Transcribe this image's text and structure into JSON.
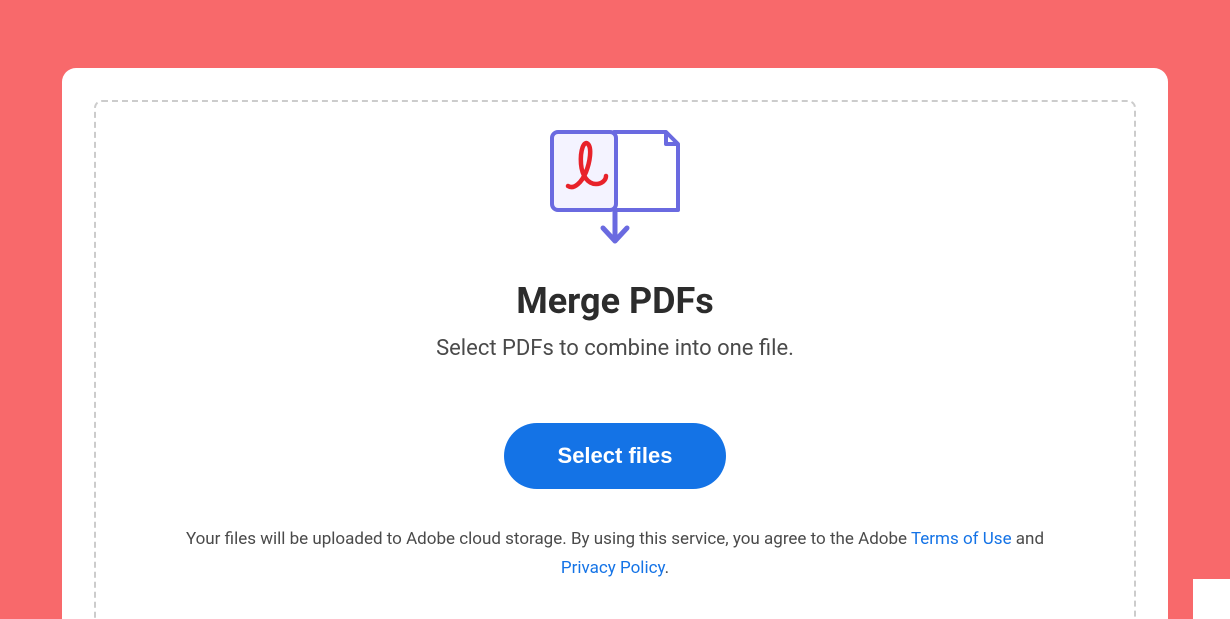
{
  "main": {
    "title": "Merge PDFs",
    "subtitle": "Select PDFs to combine into one file.",
    "button_label": "Select files"
  },
  "disclaimer": {
    "text_before": "Your files will be uploaded to Adobe cloud storage.  By using this service, you agree to the Adobe ",
    "terms_link": "Terms of Use",
    "text_mid": " and ",
    "privacy_link": "Privacy Policy",
    "text_after": "."
  }
}
